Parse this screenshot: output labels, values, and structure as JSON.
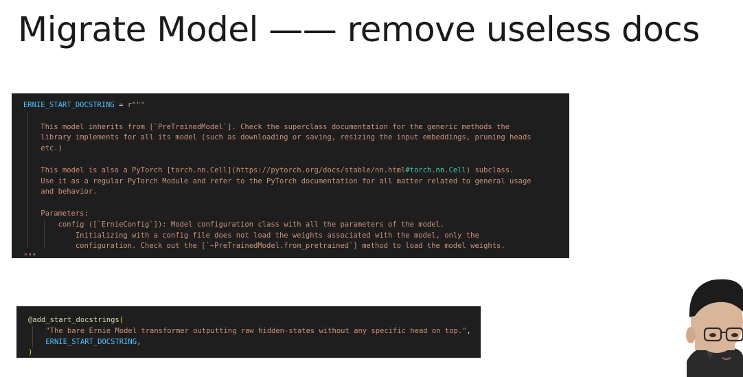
{
  "slide": {
    "title": "Migrate Model —— remove useless docs"
  },
  "code_snippet_1": {
    "lines": [
      {
        "var": "ERNIE_START_DOCSTRING",
        "op": " = ",
        "str": "r\"\"\""
      },
      {
        "str": ""
      },
      {
        "str": "    This model inherits from [`PreTrainedModel`]. Check the superclass documentation for the generic methods the"
      },
      {
        "str": "    library implements for all its model (such as downloading or saving, resizing the input embeddings, pruning heads"
      },
      {
        "str": "    etc.)"
      },
      {
        "str": ""
      },
      {
        "str": "    This model is also a PyTorch [torch.nn.Cell](https://pytorch.org/docs/stable/nn.html",
        "link": "#torch.nn.Cell",
        "str2": ") subclass."
      },
      {
        "str": "    Use it as a regular PyTorch Module and refer to the PyTorch documentation for all matter related to general usage"
      },
      {
        "str": "    and behavior."
      },
      {
        "str": ""
      },
      {
        "str": "    Parameters:"
      },
      {
        "str": "        config ([`ErnieConfig`]): Model configuration class with all the parameters of the model."
      },
      {
        "str": "            Initializing with a config file does not load the weights associated with the model, only the"
      },
      {
        "str": "            configuration. Check out the [`~PreTrainedModel.from_pretrained`] method to load the model weights."
      },
      {
        "str": "\"\"\""
      }
    ]
  },
  "code_snippet_2": {
    "decorator": "@add_start_docstrings",
    "open_paren": "(",
    "arg_string": "\"The bare Ernie Model transformer outputting raw hidden-states without any specific head on top.\"",
    "arg_comma": ",",
    "arg_var": "ERNIE_START_DOCSTRING",
    "arg_var_comma": ",",
    "close_paren": ")"
  },
  "colors": {
    "editor_bg": "#1e1e1e",
    "string": "#ce9178",
    "variable": "#4fc1ff",
    "link": "#4ec9b0",
    "decorator": "#dcdcaa",
    "bracket": "#ffd700"
  }
}
